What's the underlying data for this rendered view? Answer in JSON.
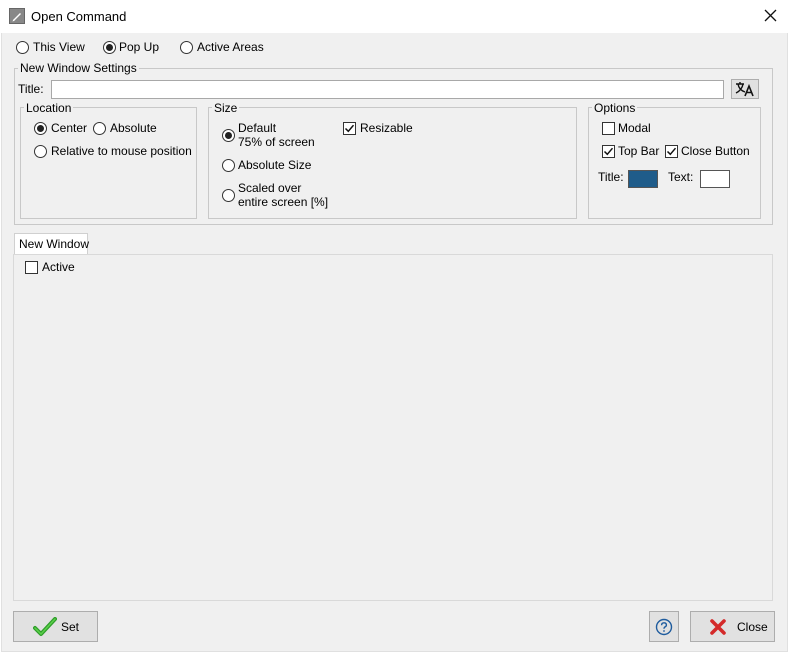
{
  "window": {
    "title": "Open Command"
  },
  "target_mode": {
    "options": [
      "This View",
      "Pop Up",
      "Active Areas"
    ],
    "selected": "Pop Up"
  },
  "new_window_settings": {
    "legend": "New Window Settings",
    "title_label": "Title:",
    "title_value": "",
    "location": {
      "legend": "Location",
      "center": "Center",
      "absolute": "Absolute",
      "relative": "Relative to mouse position",
      "selected": "Center"
    },
    "size": {
      "legend": "Size",
      "default_line1": "Default",
      "default_line2": "75% of screen",
      "absolute_size": "Absolute Size",
      "scaled_line1": "Scaled over",
      "scaled_line2": "entire screen [%]",
      "resizable": "Resizable",
      "resizable_checked": true,
      "selected": "Default"
    },
    "options": {
      "legend": "Options",
      "modal": "Modal",
      "modal_checked": false,
      "top_bar": "Top Bar",
      "top_bar_checked": true,
      "close_button": "Close Button",
      "close_button_checked": true,
      "title_color_label": "Title:",
      "title_color": "#1f5c8a",
      "text_color_label": "Text:",
      "text_color": "#ffffff"
    }
  },
  "tabs": [
    {
      "label": "New Window"
    }
  ],
  "tab_content": {
    "active_label": "Active",
    "active_checked": false
  },
  "footer": {
    "set_label": "Set",
    "close_label": "Close"
  },
  "icons": {
    "app": "pencil-icon",
    "translate": "translate-icon",
    "set": "green-check-icon",
    "help": "question-icon",
    "close": "red-x-icon"
  }
}
